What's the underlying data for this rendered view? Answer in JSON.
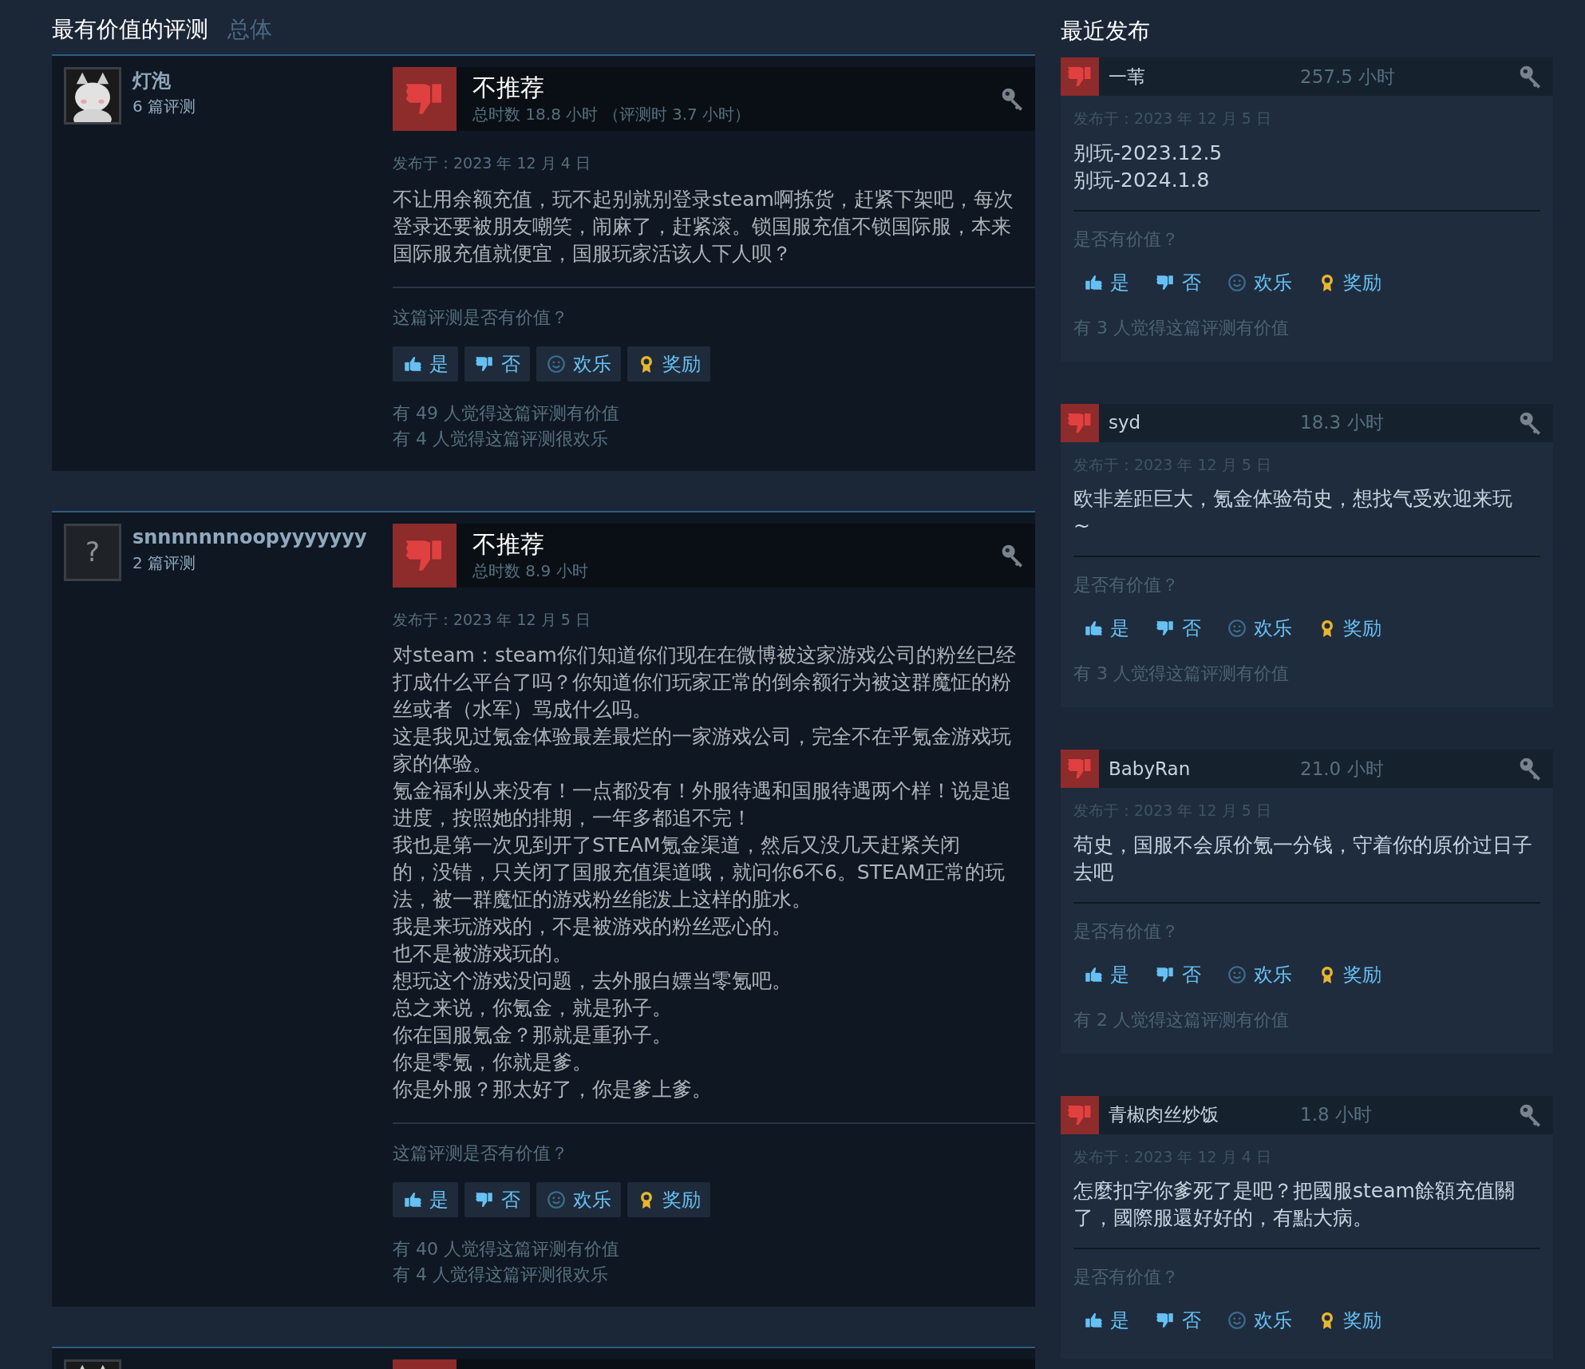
{
  "most_helpful": {
    "title": "最有价值的评测",
    "filter": "总体",
    "reviews": [
      {
        "avatar": {
          "kind": "picture"
        },
        "author": "灯泡",
        "review_count": "6 篇评测",
        "recommended": false,
        "verdict": "不推荐",
        "playtime": "总时数 18.8 小时",
        "playtime_at_review": "（评测时 3.7 小时）",
        "posted": "发布于：2023 年 12 月 4 日",
        "paragraphs": [
          "不让用余额充值，玩不起别就别登录steam啊拣货，赶紧下架吧，每次登录还要被朋友嘲笑，闹麻了，赶紧滚。锁国服充值不锁国际服，本来国际服充值就便宜，国服玩家活该人下人呗？"
        ],
        "helpful_prompt": "这篇评测是否有价值？",
        "vote_buttons": [
          {
            "kind": "yes",
            "label": "是"
          },
          {
            "kind": "no",
            "label": "否"
          },
          {
            "kind": "funny",
            "label": "欢乐"
          },
          {
            "kind": "award",
            "label": "奖励"
          }
        ],
        "helpful_count": "有 49 人觉得这篇评测有价值",
        "funny_count": "有 4 人觉得这篇评测很欢乐"
      },
      {
        "avatar": {
          "kind": "unknown",
          "text": "?"
        },
        "author": "snnnnnnnoopyyyyyyy",
        "review_count": "2 篇评测",
        "recommended": false,
        "verdict": "不推荐",
        "playtime": "总时数 8.9 小时",
        "posted": "发布于：2023 年 12 月 5 日",
        "paragraphs": [
          "对steam：steam你们知道你们现在在微博被这家游戏公司的粉丝已经打成什么平台了吗？你知道你们玩家正常的倒余额行为被这群魔怔的粉丝或者（水军）骂成什么吗。",
          "这是我见过氪金体验最差最烂的一家游戏公司，完全不在乎氪金游戏玩家的体验。",
          "氪金福利从来没有！一点都没有！外服待遇和国服待遇两个样！说是追进度，按照她的排期，一年多都追不完！",
          "我也是第一次见到开了STEAM氪金渠道，然后又没几天赶紧关闭",
          "的，没错，只关闭了国服充值渠道哦，就问你6不6。STEAM正常的玩法，被一群魔怔的游戏粉丝能泼上这样的脏水。",
          "我是来玩游戏的，不是被游戏的粉丝恶心的。",
          "也不是被游戏玩的。",
          "想玩这个游戏没问题，去外服白嫖当零氪吧。",
          "总之来说，你氪金，就是孙子。",
          "你在国服氪金？那就是重孙子。",
          "你是零氪，你就是爹。",
          "你是外服？那太好了，你是爹上爹。"
        ],
        "helpful_prompt": "这篇评测是否有价值？",
        "vote_buttons": [
          {
            "kind": "yes",
            "label": "是"
          },
          {
            "kind": "no",
            "label": "否"
          },
          {
            "kind": "funny",
            "label": "欢乐"
          },
          {
            "kind": "award",
            "label": "奖励"
          }
        ],
        "helpful_count": "有 40 人觉得这篇评测有价值",
        "funny_count": "有 4 人觉得这篇评测很欢乐"
      },
      {
        "avatar": {
          "kind": "picture"
        },
        "recommended": false
      }
    ]
  },
  "recent": {
    "title": "最近发布",
    "reviews": [
      {
        "author": "一苇",
        "recommended": false,
        "playtime": "257.5 小时",
        "posted": "发布于：2023 年 12 月 5 日",
        "paragraphs": [
          "别玩-2023.12.5",
          "别玩-2024.1.8"
        ],
        "helpful_prompt": "是否有价值？",
        "vote_buttons": [
          {
            "kind": "yes",
            "label": "是"
          },
          {
            "kind": "no",
            "label": "否"
          },
          {
            "kind": "funny",
            "label": "欢乐"
          },
          {
            "kind": "award",
            "label": "奖励"
          }
        ],
        "helpful_count": "有 3 人觉得这篇评测有价值"
      },
      {
        "author": "syd",
        "recommended": false,
        "playtime": "18.3 小时",
        "posted": "发布于：2023 年 12 月 5 日",
        "paragraphs": [
          "欧非差距巨大，氪金体验苟史，想找气受欢迎来玩",
          "~"
        ],
        "helpful_prompt": "是否有价值？",
        "vote_buttons": [
          {
            "kind": "yes",
            "label": "是"
          },
          {
            "kind": "no",
            "label": "否"
          },
          {
            "kind": "funny",
            "label": "欢乐"
          },
          {
            "kind": "award",
            "label": "奖励"
          }
        ],
        "helpful_count": "有 3 人觉得这篇评测有价值"
      },
      {
        "author": "BabyRan",
        "recommended": false,
        "playtime": "21.0 小时",
        "posted": "发布于：2023 年 12 月 5 日",
        "paragraphs": [
          "苟史，国服不会原价氪一分钱，守着你的原价过日子去吧"
        ],
        "helpful_prompt": "是否有价值？",
        "vote_buttons": [
          {
            "kind": "yes",
            "label": "是"
          },
          {
            "kind": "no",
            "label": "否"
          },
          {
            "kind": "funny",
            "label": "欢乐"
          },
          {
            "kind": "award",
            "label": "奖励"
          }
        ],
        "helpful_count": "有 2 人觉得这篇评测有价值"
      },
      {
        "author": "青椒肉丝炒饭",
        "recommended": false,
        "playtime": "1.8 小时",
        "posted": "发布于：2023 年 12 月 4 日",
        "paragraphs": [
          "怎麼扣字你爹死了是吧？把國服steam餘額充值關了，國際服還好好的，有點大病。"
        ],
        "helpful_prompt": "是否有价值？",
        "vote_buttons": [
          {
            "kind": "yes",
            "label": "是"
          },
          {
            "kind": "no",
            "label": "否"
          },
          {
            "kind": "funny",
            "label": "欢乐"
          },
          {
            "kind": "award",
            "label": "奖励"
          }
        ]
      }
    ]
  }
}
